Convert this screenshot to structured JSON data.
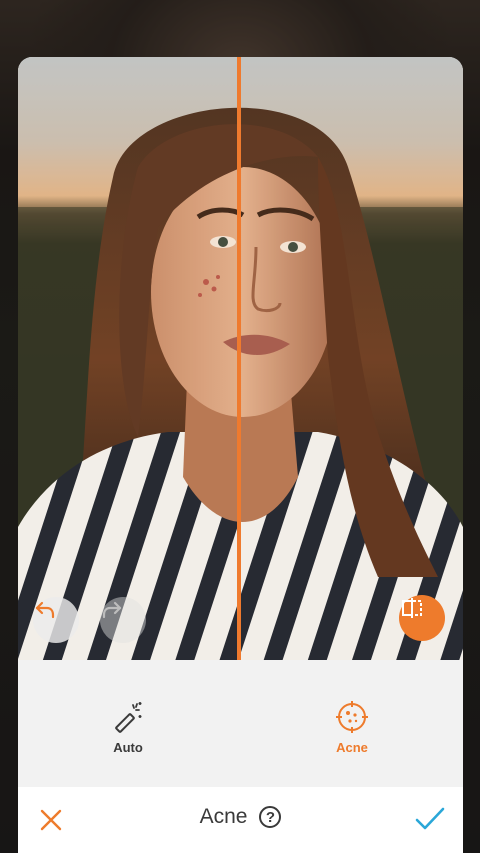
{
  "tools": {
    "auto_label": "Auto",
    "acne_label": "Acne",
    "active_tool": "acne"
  },
  "bottom_bar": {
    "title": "Acne",
    "help_glyph": "?"
  },
  "icons": {
    "undo": "undo-icon",
    "redo": "redo-icon",
    "compare": "compare-icon",
    "auto": "magic-wand-icon",
    "acne": "acne-target-icon",
    "close": "close-icon",
    "confirm": "checkmark-icon"
  },
  "colors": {
    "accent": "#ee7b2c",
    "confirm": "#2aa7d8",
    "text": "#3a3a3a"
  }
}
